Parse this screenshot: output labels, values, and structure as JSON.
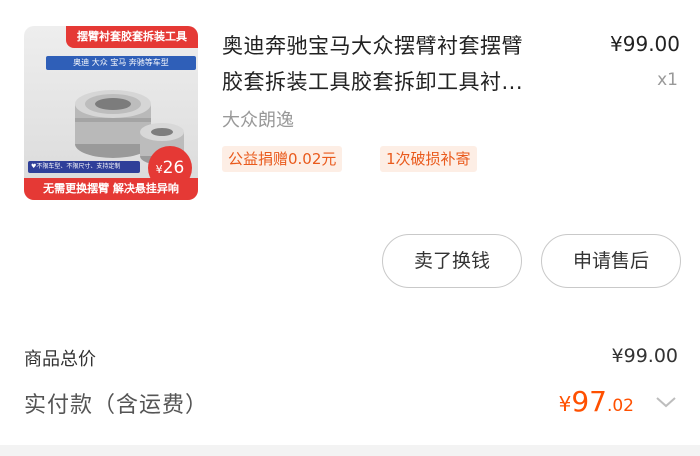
{
  "product": {
    "thumbnail": {
      "top_banner": "摆臂衬套胶套拆装工具",
      "blue_strip": "奥迪 大众 宝马 奔驰等车型",
      "tags_strip": "♥不限车型、不限尺寸、支持定制",
      "price_currency": "¥",
      "price_value": "26",
      "bottom_banner": "无需更换摆臂 解决悬挂异响"
    },
    "title_line1": "奥迪奔驰宝马大众摆臂衬套摆臂",
    "title_line2": "胶套拆装工具胶套拆卸工具衬...",
    "price": "¥99.00",
    "quantity": "x1",
    "variant": "大众朗逸",
    "badges": {
      "donate": "公益捐赠0.02元",
      "repair": "1次破损补寄"
    }
  },
  "actions": {
    "sell_label": "卖了换钱",
    "after_sale_label": "申请售后"
  },
  "totals": {
    "goods_total_label": "商品总价",
    "goods_total_value": "¥99.00",
    "paid_label": "实付款（含运费）",
    "paid_currency": "¥",
    "paid_integer": "97",
    "paid_decimal": ".02"
  },
  "colors": {
    "accent": "#ff5000",
    "badge_bg": "#fdeee5",
    "badge_text": "#e95a1c",
    "thumb_red": "#e53935",
    "thumb_blue": "#2f5fb8"
  },
  "icons": {
    "expand": "chevron-down-icon"
  }
}
